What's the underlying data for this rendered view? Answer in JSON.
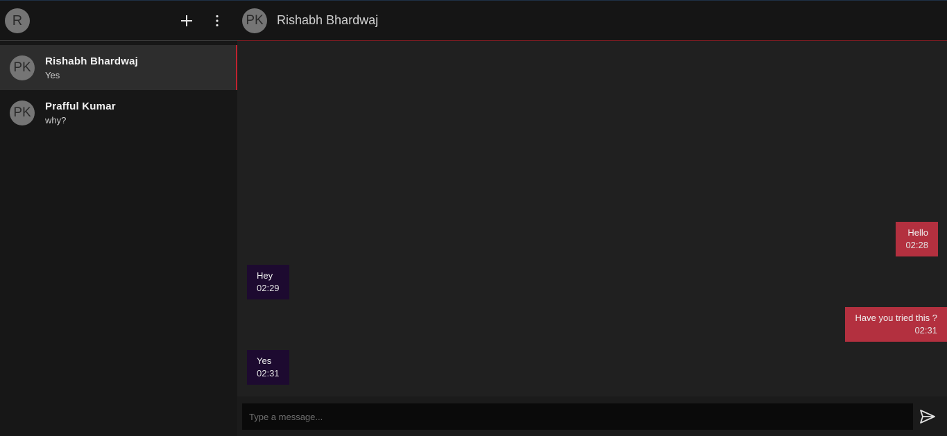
{
  "sidebar": {
    "user_avatar": "R",
    "icons": {
      "add": "plus-icon",
      "menu": "more-vert-icon"
    },
    "chats": [
      {
        "avatar": "PK",
        "name": "Rishabh Bhardwaj",
        "last_message": "Yes",
        "active": true
      },
      {
        "avatar": "PK",
        "name": "Prafful Kumar",
        "last_message": "why?",
        "active": false
      }
    ]
  },
  "conversation": {
    "avatar": "PK",
    "title": "Rishabh Bhardwaj"
  },
  "messages": [
    {
      "direction": "sent",
      "text": "Hello",
      "time": "02:28"
    },
    {
      "direction": "received",
      "text": "Hey",
      "time": "02:29"
    },
    {
      "direction": "sent",
      "text": "Have you tried this ?",
      "time": "02:31"
    },
    {
      "direction": "received",
      "text": "Yes",
      "time": "02:31"
    }
  ],
  "composer": {
    "placeholder": "Type a message...",
    "send_icon": "send-icon"
  },
  "colors": {
    "accent": "#c0232f",
    "sent_bubble": "#b3303f",
    "received_bubble": "#1d0a30",
    "avatar": "#757575"
  }
}
